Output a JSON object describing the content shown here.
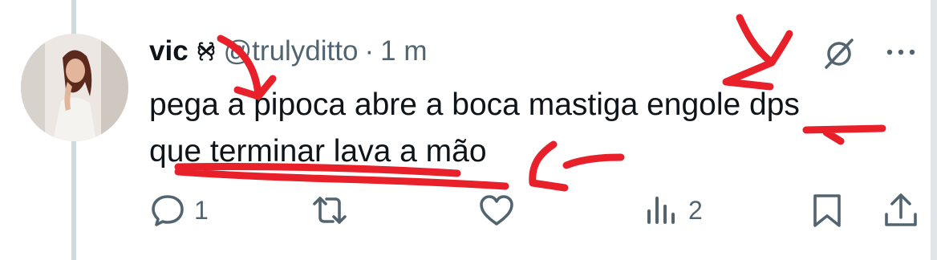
{
  "author": {
    "display_name": "vic",
    "name_badge_icon": "four-leaf-clover-icon",
    "handle": "@trulyditto",
    "separator": "·",
    "time": "1 m"
  },
  "tweet": {
    "line1": "pega a pipoca abre a boca mastiga engole dps",
    "line2": "que terminar lava a mão"
  },
  "actions": {
    "reply_count": "1",
    "retweet_count": "",
    "like_count": "",
    "views_count": "2"
  },
  "colors": {
    "text": "#0f1419",
    "secondary": "#536471",
    "annotation": "#e8202a"
  }
}
